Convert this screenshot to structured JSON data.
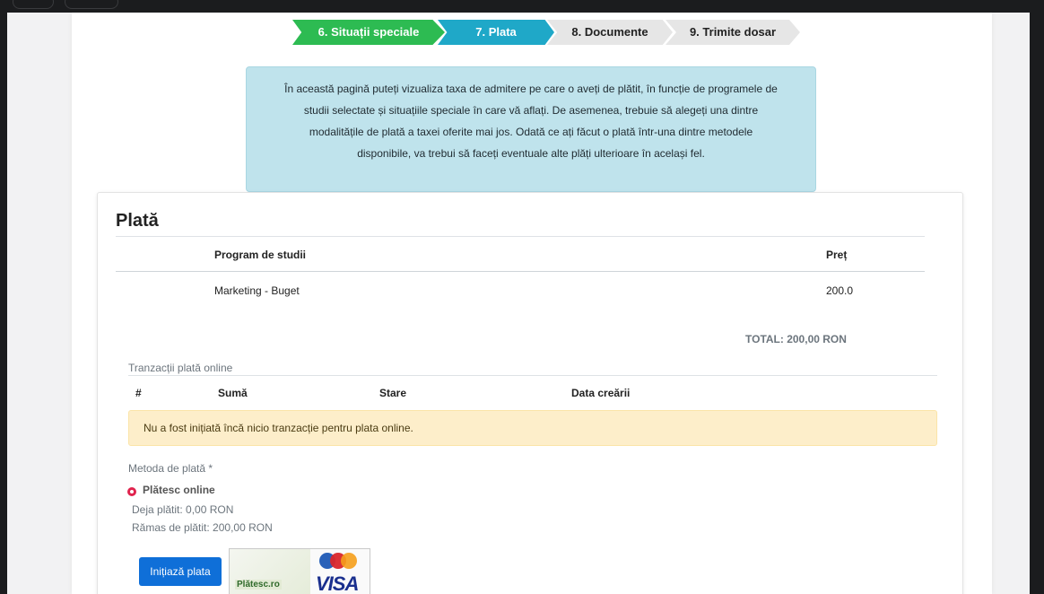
{
  "steps": [
    {
      "label": "6. Situații speciale"
    },
    {
      "label": "7. Plata"
    },
    {
      "label": "8. Documente"
    },
    {
      "label": "9. Trimite dosar"
    }
  ],
  "info": {
    "line1": "În această pagină puteți vizualiza taxa de admitere pe care o aveți de plătit, în funcție de programele de",
    "line2": "studii selectate și situațiile speciale în care vă aflați. De asemenea, trebuie să alegeți una dintre",
    "line3": "modalitățile de plată a taxei oferite mai jos. Odată ce ați făcut o plată într-una dintre metodele",
    "line4": "disponibile, va trebui să faceți eventuale alte plăți ulterioare în același fel."
  },
  "card": {
    "title": "Plată",
    "table": {
      "headers": {
        "program": "Program de studii",
        "price": "Preț"
      },
      "rows": [
        {
          "program": "Marketing - Buget",
          "price": "200.0"
        }
      ]
    },
    "total": "TOTAL: 200,00 RON",
    "transactions": {
      "title": "Tranzacții plată online",
      "headers": {
        "num": "#",
        "sum": "Sumă",
        "status": "Stare",
        "date": "Data creării"
      },
      "empty_message": "Nu a fost inițiată încă nicio tranzacție pentru plata online."
    },
    "payment": {
      "label": "Metoda de plată *",
      "option": "Plătesc online",
      "paid": "Deja plătit: 0,00 RON",
      "remaining": "Rămas de plătit: 200,00 RON",
      "button": "Inițiază plata",
      "logo_text": "Plătesc.ro",
      "card_brand": "VISA"
    }
  },
  "colors": {
    "step_done": "#2dbb52",
    "step_active": "#1fa8c8",
    "button": "#0f6fd8",
    "alert_bg": "#fdeeca",
    "info_bg": "#bfe3ec"
  }
}
